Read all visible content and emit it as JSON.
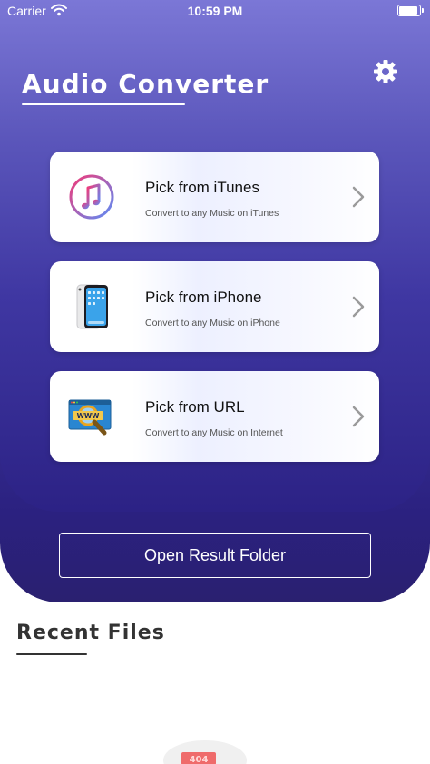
{
  "status_bar": {
    "carrier": "Carrier",
    "time": "10:59 PM"
  },
  "header": {
    "title": "Audio Converter",
    "settings_icon": "gear-icon"
  },
  "cards": [
    {
      "title": "Pick from iTunes",
      "subtitle": "Convert to any Music on iTunes",
      "icon": "itunes-icon"
    },
    {
      "title": "Pick from iPhone",
      "subtitle": "Convert to any Music on iPhone",
      "icon": "iphone-icon"
    },
    {
      "title": "Pick from URL",
      "subtitle": "Convert to any Music on Internet",
      "icon": "www-magnifier-icon"
    }
  ],
  "result_button": {
    "label": "Open Result Folder"
  },
  "recent": {
    "title": "Recent Files",
    "empty_badge": "404"
  },
  "colors": {
    "gradient_top": "#7b77d6",
    "gradient_bottom": "#2a2070",
    "itunes_pink": "#f23a78",
    "itunes_blue": "#5b8df7"
  }
}
